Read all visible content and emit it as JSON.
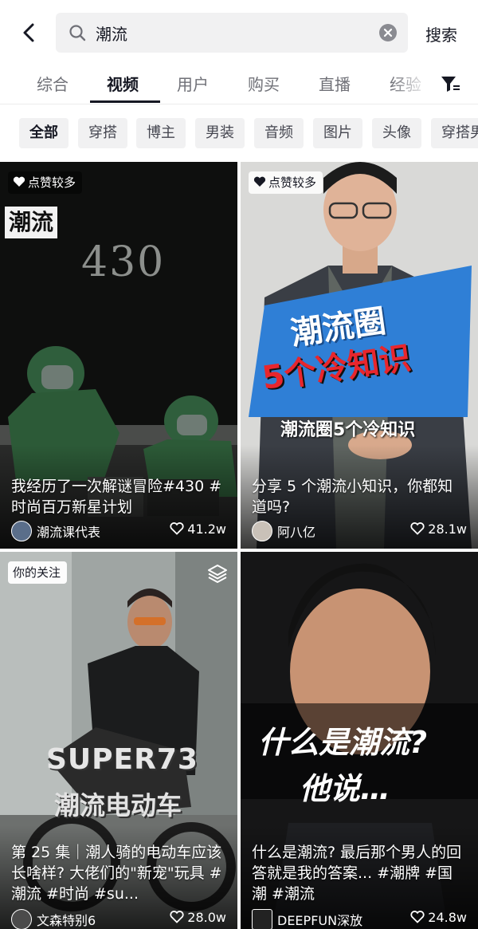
{
  "search": {
    "query": "潮流",
    "button_label": "搜索"
  },
  "tabs": [
    {
      "label": "综合"
    },
    {
      "label": "视频"
    },
    {
      "label": "用户"
    },
    {
      "label": "购买"
    },
    {
      "label": "直播"
    },
    {
      "label": "经验"
    }
  ],
  "chips": [
    {
      "label": "全部"
    },
    {
      "label": "穿搭"
    },
    {
      "label": "博主"
    },
    {
      "label": "男装"
    },
    {
      "label": "音频"
    },
    {
      "label": "图片"
    },
    {
      "label": "头像"
    },
    {
      "label": "穿搭男"
    }
  ],
  "cards": [
    {
      "badge": "点赞较多",
      "caption": "我经历了一次解谜冒险#430 #时尚百万新星计划",
      "author": "潮流课代表",
      "likes": "41.2w",
      "overlay_tag": "潮流",
      "overlay_number": "430"
    },
    {
      "badge": "点赞较多",
      "caption": "分享 5 个潮流小知识，你都知道吗?",
      "author": "阿八亿",
      "likes": "28.1w",
      "overlay_title_1": "潮流圈",
      "overlay_title_2": "5个冷知识",
      "overlay_subtitle": "潮流圈5个冷知识"
    },
    {
      "badge": "你的关注",
      "caption": "第 25 集｜潮人骑的电动车应该长啥样? 大佬们的\"新宠\"玩具 #潮流 #时尚 #su...",
      "author": "文森特别6",
      "likes": "28.0w",
      "overlay_brand": "SUPER73",
      "overlay_title": "潮流电动车"
    },
    {
      "badge": "",
      "caption": "什么是潮流? 最后那个男人的回答就是我的答案... #潮牌 #国潮 #潮流",
      "author": "DEEPFUN深放",
      "likes": "24.8w",
      "overlay_line_1": "什么是潮流?",
      "overlay_line_2": "他说…"
    }
  ],
  "colors": {
    "text_primary": "#161823",
    "text_secondary": "#6f7077",
    "chip_bg": "#f1f1f2"
  }
}
